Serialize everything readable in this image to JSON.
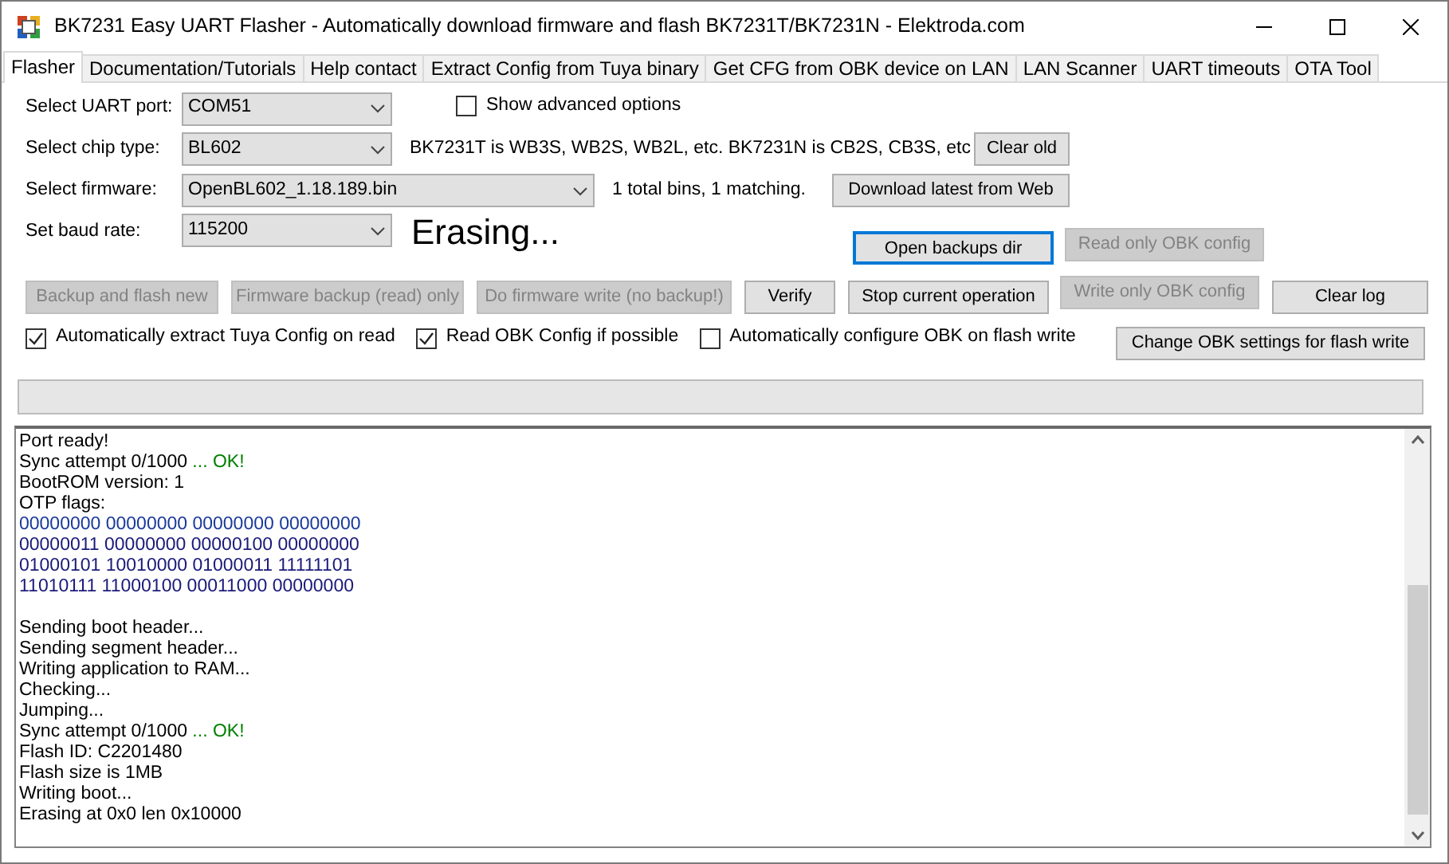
{
  "window": {
    "title": "BK7231 Easy UART Flasher - Automatically download firmware and flash BK7231T/BK7231N  - Elektroda.com"
  },
  "tabs": [
    {
      "label": "Flasher",
      "selected": true
    },
    {
      "label": "Documentation/Tutorials",
      "selected": false
    },
    {
      "label": "Help contact",
      "selected": false
    },
    {
      "label": "Extract Config from Tuya binary",
      "selected": false
    },
    {
      "label": "Get CFG from OBK device on LAN",
      "selected": false
    },
    {
      "label": "LAN Scanner",
      "selected": false
    },
    {
      "label": "UART timeouts",
      "selected": false
    },
    {
      "label": "OTA Tool",
      "selected": false
    }
  ],
  "uart_port": {
    "label": "Select UART port:",
    "value": "COM51"
  },
  "show_advanced": {
    "label": "Show advanced options",
    "checked": false
  },
  "chip_type": {
    "label": "Select chip type:",
    "value": "BL602"
  },
  "chip_hint": "BK7231T is WB3S, WB2S, WB2L, etc. BK7231N is CB2S, CB3S, etc",
  "clear_old": {
    "label": "Clear old",
    "disabled": false
  },
  "firmware": {
    "label": "Select firmware:",
    "value": "OpenBL602_1.18.189.bin"
  },
  "bins_info": "1 total bins, 1 matching.",
  "download": {
    "label": "Download latest from Web",
    "disabled": false
  },
  "baud_rate": {
    "label": "Set baud rate:",
    "value": "115200"
  },
  "status": "Erasing...",
  "open_backups": {
    "label": "Open backups dir",
    "disabled": false,
    "focused": true
  },
  "read_obk": {
    "label": "Read only OBK config",
    "disabled": true
  },
  "action_buttons": [
    {
      "label": "Backup and flash new",
      "disabled": true
    },
    {
      "label": "Firmware backup (read) only",
      "disabled": true
    },
    {
      "label": "Do firmware write (no backup!)",
      "disabled": true
    },
    {
      "label": "Verify",
      "disabled": false
    },
    {
      "label": "Stop current operation",
      "disabled": false
    }
  ],
  "write_obk": {
    "label": "Write only OBK config",
    "disabled": true
  },
  "clear_log": {
    "label": "Clear log",
    "disabled": false
  },
  "checkboxes": [
    {
      "label": "Automatically extract Tuya Config on read",
      "checked": true
    },
    {
      "label": "Read OBK Config if possible",
      "checked": true
    },
    {
      "label": "Automatically configure OBK on flash write",
      "checked": false
    }
  ],
  "change_obk": {
    "label": "Change OBK settings for flash write",
    "disabled": false
  },
  "progress": {
    "level": 0
  },
  "log": [
    {
      "kind": "text",
      "segments": [
        {
          "text": "Port ready!",
          "color": "#000000"
        }
      ]
    },
    {
      "kind": "text",
      "segments": [
        {
          "text": "Sync attempt 0/1000",
          "color": "#000000"
        },
        {
          "text": " ... OK!",
          "color": "#008000"
        }
      ]
    },
    {
      "kind": "text",
      "segments": [
        {
          "text": "BootROM version: 1",
          "color": "#000000"
        }
      ]
    },
    {
      "kind": "text",
      "segments": [
        {
          "text": "OTP flags:",
          "color": "#000000"
        }
      ]
    },
    {
      "kind": "text",
      "segments": [
        {
          "text": "00000000 00000000 00000000 00000000",
          "color": "#1a3a9c"
        }
      ]
    },
    {
      "kind": "text",
      "segments": [
        {
          "text": "00000011 00000000 00000100 00000000",
          "color": "#1a1a7a"
        }
      ]
    },
    {
      "kind": "text",
      "segments": [
        {
          "text": "01000101 10010000 01000011 11111101",
          "color": "#1a1a7a"
        }
      ]
    },
    {
      "kind": "text",
      "segments": [
        {
          "text": "11010111 11000100 00011000 00000000",
          "color": "#1a1a7a"
        }
      ]
    },
    {
      "kind": "blank"
    },
    {
      "kind": "text",
      "segments": [
        {
          "text": "Sending boot header...",
          "color": "#000000"
        }
      ]
    },
    {
      "kind": "text",
      "segments": [
        {
          "text": "Sending segment header...",
          "color": "#000000"
        }
      ]
    },
    {
      "kind": "text",
      "segments": [
        {
          "text": "Writing application to RAM...",
          "color": "#000000"
        }
      ]
    },
    {
      "kind": "text",
      "segments": [
        {
          "text": "Checking...",
          "color": "#000000"
        }
      ]
    },
    {
      "kind": "text",
      "segments": [
        {
          "text": "Jumping...",
          "color": "#000000"
        }
      ]
    },
    {
      "kind": "text",
      "segments": [
        {
          "text": "Sync attempt 0/1000",
          "color": "#000000"
        },
        {
          "text": " ... OK!",
          "color": "#008000"
        }
      ]
    },
    {
      "kind": "text",
      "segments": [
        {
          "text": "Flash ID: C2201480",
          "color": "#000000"
        }
      ]
    },
    {
      "kind": "text",
      "segments": [
        {
          "text": "Flash size is 1MB",
          "color": "#000000"
        }
      ]
    },
    {
      "kind": "text",
      "segments": [
        {
          "text": "Writing boot...",
          "color": "#000000"
        }
      ]
    },
    {
      "kind": "text",
      "segments": [
        {
          "text": "Erasing at 0x0 len 0x10000",
          "color": "#000000"
        }
      ]
    }
  ]
}
